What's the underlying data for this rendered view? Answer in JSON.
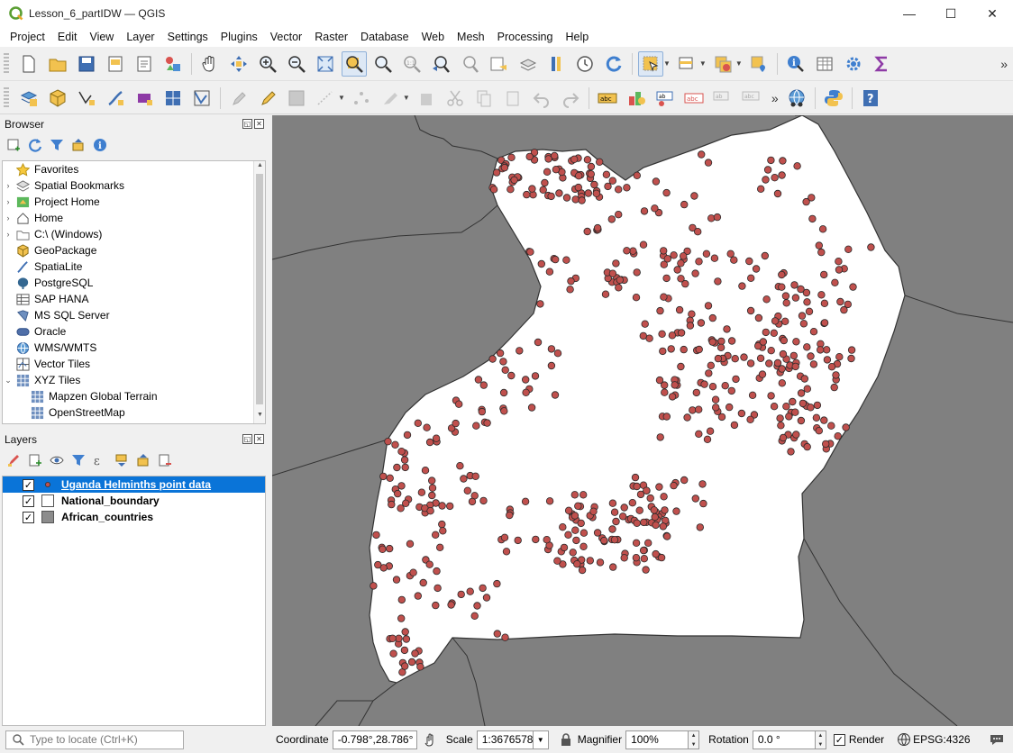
{
  "window": {
    "title": "Lesson_6_partIDW — QGIS",
    "minimize": "—",
    "maximize": "☐",
    "close": "✕"
  },
  "menu": [
    "Project",
    "Edit",
    "View",
    "Layer",
    "Settings",
    "Plugins",
    "Vector",
    "Raster",
    "Database",
    "Web",
    "Mesh",
    "Processing",
    "Help"
  ],
  "toolbar_more": "»",
  "browser": {
    "title": "Browser",
    "items": [
      {
        "label": "Favorites",
        "expander": "",
        "icon": "star-icon"
      },
      {
        "label": "Spatial Bookmarks",
        "expander": "›",
        "icon": "bookmark-icon"
      },
      {
        "label": "Project Home",
        "expander": "›",
        "icon": "project-home-icon"
      },
      {
        "label": "Home",
        "expander": "›",
        "icon": "home-icon"
      },
      {
        "label": "C:\\ (Windows)",
        "expander": "›",
        "icon": "drive-icon"
      },
      {
        "label": "GeoPackage",
        "expander": "",
        "icon": "geopackage-icon"
      },
      {
        "label": "SpatiaLite",
        "expander": "",
        "icon": "spatialite-icon"
      },
      {
        "label": "PostgreSQL",
        "expander": "",
        "icon": "postgresql-icon"
      },
      {
        "label": "SAP HANA",
        "expander": "",
        "icon": "sap-hana-icon"
      },
      {
        "label": "MS SQL Server",
        "expander": "",
        "icon": "mssql-icon"
      },
      {
        "label": "Oracle",
        "expander": "",
        "icon": "oracle-icon"
      },
      {
        "label": "WMS/WMTS",
        "expander": "",
        "icon": "wms-icon"
      },
      {
        "label": "Vector Tiles",
        "expander": "",
        "icon": "vector-tiles-icon"
      },
      {
        "label": "XYZ Tiles",
        "expander": "⌄",
        "icon": "xyz-tiles-icon"
      },
      {
        "label": "Mapzen Global Terrain",
        "expander": "",
        "icon": "xyz-tile-icon",
        "indent": true
      },
      {
        "label": "OpenStreetMap",
        "expander": "",
        "icon": "xyz-tile-icon",
        "indent": true
      }
    ]
  },
  "layers": {
    "title": "Layers",
    "items": [
      {
        "label": "Uganda Helminths point data",
        "checked": "✓",
        "selected": true,
        "symbol": "point"
      },
      {
        "label": "National_boundary",
        "checked": "✓",
        "selected": false,
        "symbol": "white-fill"
      },
      {
        "label": "African_countries",
        "checked": "✓",
        "selected": false,
        "symbol": "gray-fill"
      }
    ]
  },
  "status": {
    "locate_placeholder": "Type to locate (Ctrl+K)",
    "coordinate_label": "Coordinate",
    "coordinate_value": "-0.798°,28.786°",
    "scale_label": "Scale",
    "scale_value": "1:3676578",
    "magnifier_label": "Magnifier",
    "magnifier_value": "100%",
    "rotation_label": "Rotation",
    "rotation_value": "0.0 °",
    "render_label": "Render",
    "render_checked": "✓",
    "crs": "EPSG:4326"
  },
  "colors": {
    "map_background": "#808080",
    "country_fill": "#ffffff",
    "point_fill": "#c0504d",
    "selection_blue": "#0a74d8"
  }
}
